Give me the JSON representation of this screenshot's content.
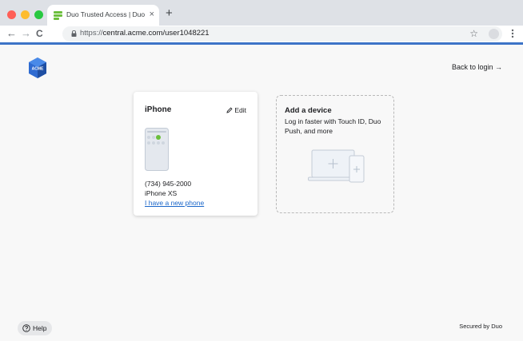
{
  "browser": {
    "tab_title": "Duo Trusted Access | Duo Sec",
    "tab_close": "×",
    "new_tab": "+",
    "url_scheme": "https://",
    "url_rest": "central.acme.com/user1048221",
    "nav": {
      "back": "←",
      "forward": "→",
      "reload": "C"
    },
    "bookmark_icon": "☆",
    "accent_color": "#3d74c7"
  },
  "header": {
    "logo_text": "ACME",
    "back_link": "Back to login →"
  },
  "device_card": {
    "name": "iPhone",
    "edit_label": "Edit",
    "phone_number": "(734) 945-2000",
    "model": "iPhone XS",
    "new_phone_link": "I have a new phone"
  },
  "add_device": {
    "title": "Add a device",
    "description": "Log in faster with Touch ID, Duo Push, and more"
  },
  "footer": {
    "help_label": "Help",
    "secured_by": "Secured by Duo"
  },
  "icons": [
    "duo-favicon-icon",
    "lock-icon",
    "star-icon",
    "menu-dots-icon",
    "pencil-icon",
    "phone-illustration",
    "laptop-tablet-illustration",
    "help-circle-icon"
  ]
}
